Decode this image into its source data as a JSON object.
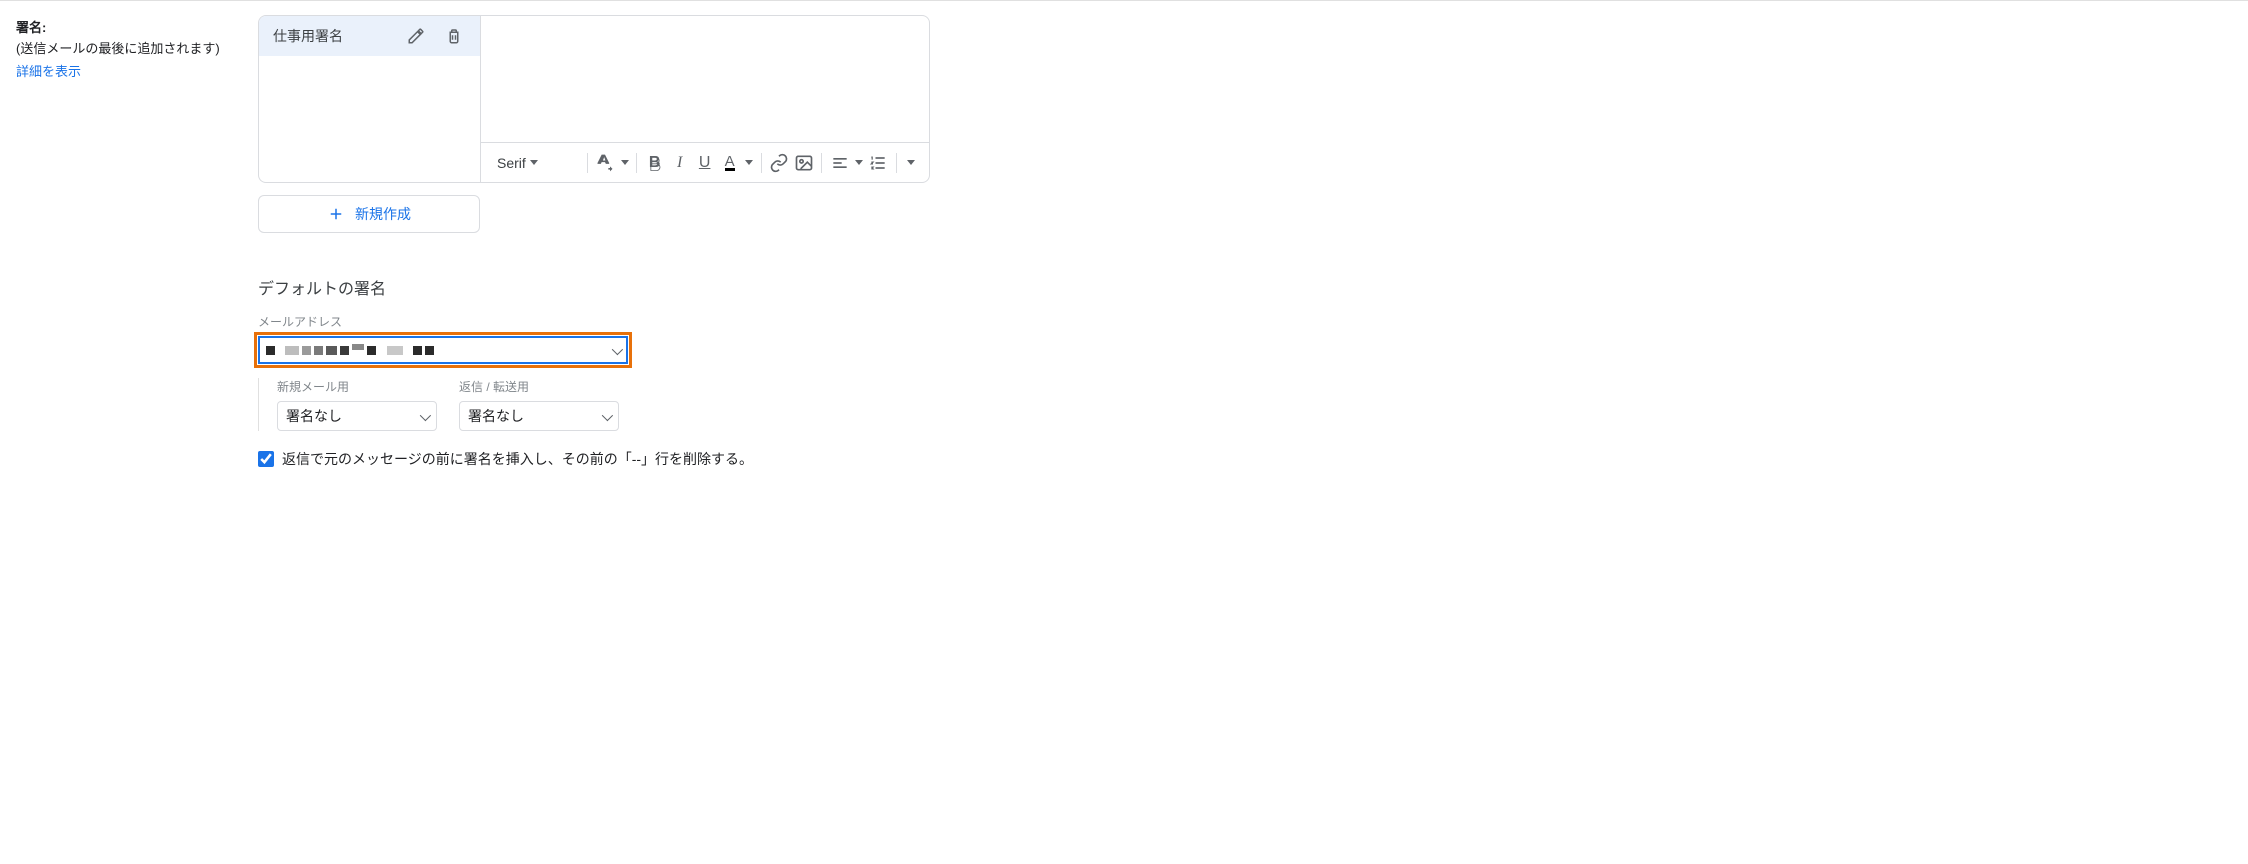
{
  "left": {
    "title": "署名:",
    "subtitle": "(送信メールの最後に追加されます)",
    "detail_link": "詳細を表示"
  },
  "signature": {
    "selected_name": "仕事用署名",
    "new_button": "新規作成",
    "toolbar": {
      "font": "Serif"
    }
  },
  "defaults": {
    "title": "デフォルトの署名",
    "email_label": "メールアドレス",
    "new_mail_label": "新規メール用",
    "reply_label": "返信 / 転送用",
    "none_option": "署名なし",
    "checkbox_label": "返信で元のメッセージの前に署名を挿入し、その前の「--」行を削除する。"
  }
}
